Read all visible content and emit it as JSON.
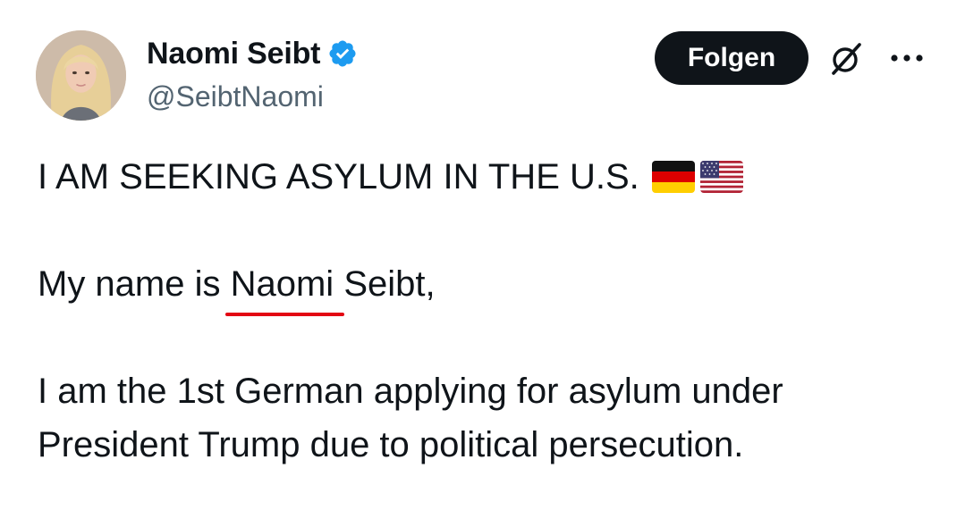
{
  "author": {
    "display_name": "Naomi Seibt",
    "handle": "@SeibtNaomi",
    "verified": true,
    "verified_color": "#1d9bf0",
    "avatar_icon": "profile-photo"
  },
  "actions": {
    "follow_label": "Folgen",
    "grok_icon": "grok-icon",
    "more_icon": "more-horizontal-icon"
  },
  "tweet": {
    "headline": "I AM SEEKING ASYLUM IN THE U.S.",
    "flags": [
      "germany-flag",
      "usa-flag"
    ],
    "name_line_prefix": "My name is ",
    "name_line_highlight": "Naomi",
    "name_line_suffix": " Seibt,",
    "body_line_1": "I am the 1st German applying for asylum under",
    "body_line_2": "President Trump due to political persecution."
  },
  "colors": {
    "text": "#0f1419",
    "secondary_text": "#536471",
    "button_bg": "#0f1419",
    "underline": "#e30613"
  }
}
